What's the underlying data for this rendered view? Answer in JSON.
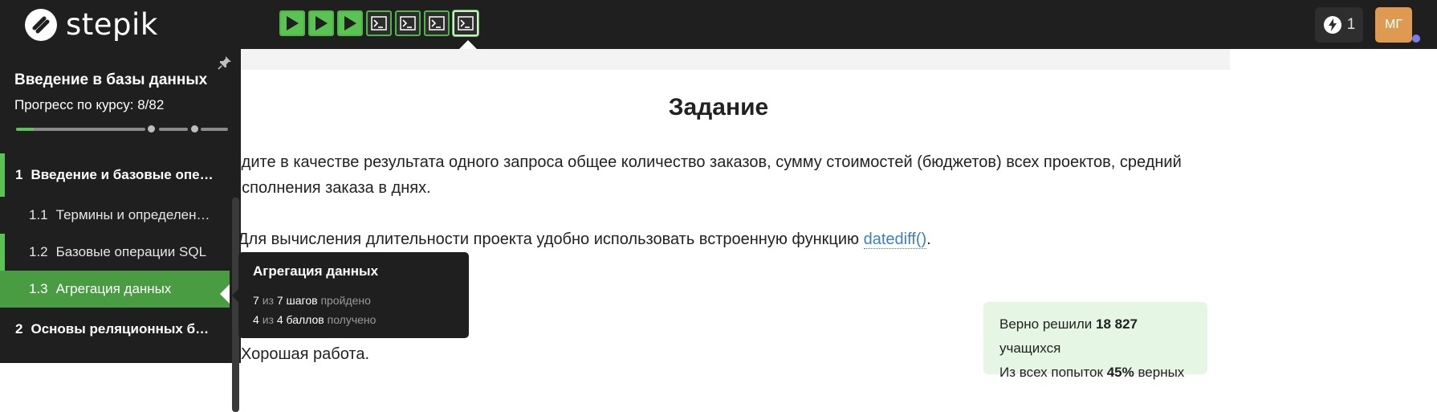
{
  "app": {
    "logo_text": "stepik"
  },
  "step_bar": {
    "steps": [
      {
        "type": "video",
        "state": "passed",
        "icon": "play-icon"
      },
      {
        "type": "video",
        "state": "passed",
        "icon": "play-icon"
      },
      {
        "type": "video",
        "state": "passed",
        "icon": "play-icon"
      },
      {
        "type": "code",
        "state": "passed",
        "icon": "terminal-icon"
      },
      {
        "type": "code",
        "state": "passed",
        "icon": "terminal-icon"
      },
      {
        "type": "code",
        "state": "passed",
        "icon": "terminal-icon"
      },
      {
        "type": "code",
        "state": "current",
        "icon": "terminal-icon"
      }
    ]
  },
  "header": {
    "energy_count": "1",
    "avatar_initials": "МГ"
  },
  "sidebar": {
    "course_title": "Введение в базы данных",
    "progress_label": "Прогресс по курсу:",
    "progress_value": "8/82",
    "items": [
      {
        "number": "1",
        "label": "Введение и базовые опе…",
        "kind": "module"
      },
      {
        "number": "1.1",
        "label": "Термины и определен…",
        "kind": "lesson"
      },
      {
        "number": "1.2",
        "label": "Базовые операции SQL",
        "kind": "lesson"
      },
      {
        "number": "1.3",
        "label": "Агрегация данных",
        "kind": "lesson",
        "active": true
      },
      {
        "number": "2",
        "label": "Основы реляционных б…",
        "kind": "module"
      }
    ]
  },
  "tooltip": {
    "title": "Агрегация данных",
    "steps_done": "7",
    "of": "из",
    "steps_total": "7 шагов",
    "steps_status": "пройдено",
    "points_done": "4",
    "points_total": "4 баллов",
    "points_status": "получено"
  },
  "main": {
    "title": "Задание",
    "para1": "едите в качестве результата одного запроса общее количество заказов, сумму стоимостей (бюджетов) всех проектов, средний",
    "para2": "исполнения заказа в днях.",
    "para3_text": "Для вычисления длительности проекта удобно использовать встроенную функцию ",
    "para3_link": "datediff()",
    "para3_end": ".",
    "good_work": "Хорошая работа."
  },
  "stats": {
    "solved_prefix": "Верно решили",
    "solved_count": "18 827",
    "solved_suffix": "учащихся",
    "attempts_prefix": "Из всех попыток",
    "attempts_percent": "45%",
    "attempts_suffix": "верных"
  },
  "colors": {
    "accent_green": "#5bc254",
    "active_green": "#4a9c43",
    "topbar_bg": "#1f1f1f",
    "avatar_bg": "#dd9a50",
    "link": "#3b7fc8",
    "stats_bg": "#e6f6e5"
  }
}
